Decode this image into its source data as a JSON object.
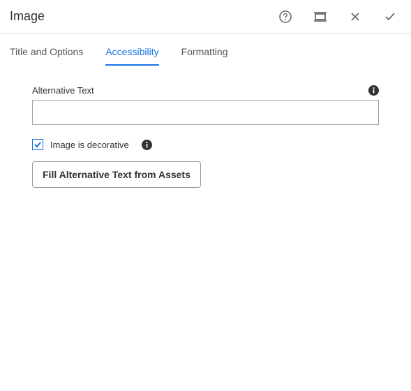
{
  "header": {
    "title": "Image"
  },
  "tabs": {
    "title_options": "Title and Options",
    "accessibility": "Accessibility",
    "formatting": "Formatting",
    "active": "accessibility"
  },
  "form": {
    "alt_text_label": "Alternative Text",
    "alt_text_value": "",
    "decorative_label": "Image is decorative",
    "decorative_checked": true,
    "fill_button_label": "Fill Alternative Text from Assets"
  }
}
